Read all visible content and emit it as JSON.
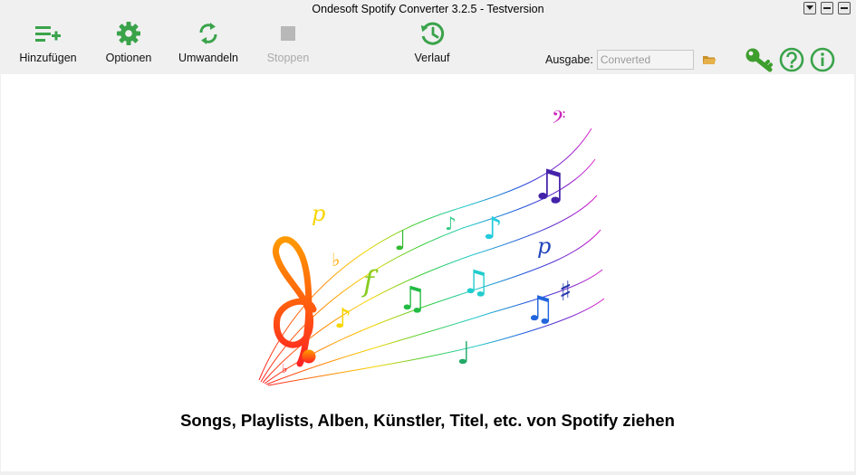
{
  "window": {
    "title": "Ondesoft Spotify Converter 3.2.5 - Testversion"
  },
  "toolbar": {
    "add_label": "Hinzufügen",
    "options_label": "Optionen",
    "convert_label": "Umwandeln",
    "stop_label": "Stoppen",
    "history_label": "Verlauf"
  },
  "output": {
    "label": "Ausgabe:",
    "value": "Converted"
  },
  "main": {
    "headline": "Songs, Playlists, Alben, Künstler, Titel, etc. von Spotify ziehen"
  },
  "colors": {
    "accent_green": "#3aa34a",
    "key_green": "#3e9e2e",
    "disabled_gray": "#b8b8b8"
  }
}
